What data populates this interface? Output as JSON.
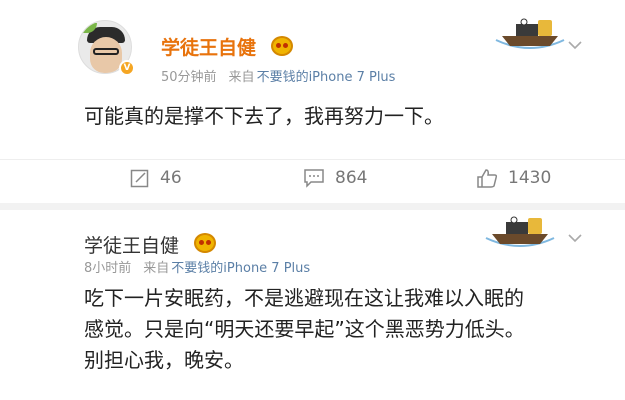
{
  "posts": [
    {
      "username": "学徒王自健",
      "time": "50分钟前",
      "from_label": "来自",
      "source": "不要钱的iPhone 7 Plus",
      "content": [
        "可能真的是撑不下去了，我再努力一下。"
      ],
      "stats": {
        "repost": "46",
        "comment": "864",
        "like": "1430"
      }
    },
    {
      "username": "学徒王自健",
      "time": "8小时前",
      "from_label": "来自",
      "source": "不要钱的iPhone 7 Plus",
      "content": [
        "吃下一片安眠药，不是逃避现在这让我难以入眠的",
        "感觉。只是向“明天还要早起”这个黑恶势力低头。",
        "别担心我，晚安。"
      ]
    }
  ],
  "colors": {
    "accent": "#e8730c",
    "link": "#5b7fa6",
    "muted": "#999999"
  },
  "icons": [
    "vip-emoji-icon",
    "boat-decoration-icon",
    "chevron-down-icon",
    "repost-icon",
    "comment-icon",
    "like-icon"
  ]
}
